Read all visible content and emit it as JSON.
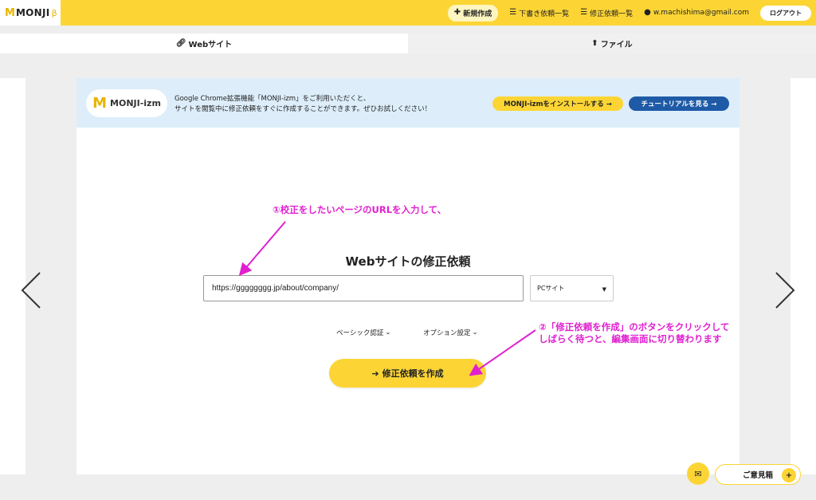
{
  "header": {
    "logo_mark": "M",
    "logo_text": "MONJI",
    "logo_beta": "β",
    "nav": {
      "new_label": "新規作成",
      "drafts_label": "下書き依頼一覧",
      "requests_label": "修正依頼一覧",
      "email": "w.machishima@gmail.com",
      "logout_label": "ログアウト"
    }
  },
  "tabs": {
    "website_label": "Webサイト",
    "file_label": "ファイル"
  },
  "banner": {
    "logo_mark": "M",
    "logo_text": "MONJI-izm",
    "line1": "Google Chrome拡張機能「MONJI-izm」をご利用いただくと、",
    "line2": "サイトを閲覧中に修正依頼をすぐに作成することができます。ぜひお試しください！",
    "install_label": "MONJI-izmをインストールする →",
    "tutorial_label": "チュートリアルを見る →"
  },
  "annotations": {
    "step1": "①校正をしたいページのURLを入力して、",
    "step2_line1": "②「修正依頼を作成」のボタンをクリックして",
    "step2_line2": "しばらく待つと、編集画面に切り替わります"
  },
  "form": {
    "title": "Webサイトの修正依頼",
    "url_value": "https://gggggggg.jp/about/company/",
    "device_selected": "PCサイト",
    "basic_auth_label": "ベーシック認証",
    "options_label": "オプション設定",
    "create_label": "修正依頼を作成"
  },
  "floating": {
    "feedback_label": "ご意見箱",
    "plus": "+"
  },
  "colors": {
    "brand_yellow": "#fcd535",
    "tutorial_blue": "#1e5aa6",
    "banner_bg": "#ddeefa",
    "annotation_pink": "#e020d0"
  },
  "icons": [
    "plus-icon",
    "list-icon",
    "user-icon",
    "link-icon",
    "upload-icon",
    "chevron-left-icon",
    "chevron-right-icon",
    "arrow-right-icon",
    "mail-icon",
    "chevron-down-icon"
  ]
}
